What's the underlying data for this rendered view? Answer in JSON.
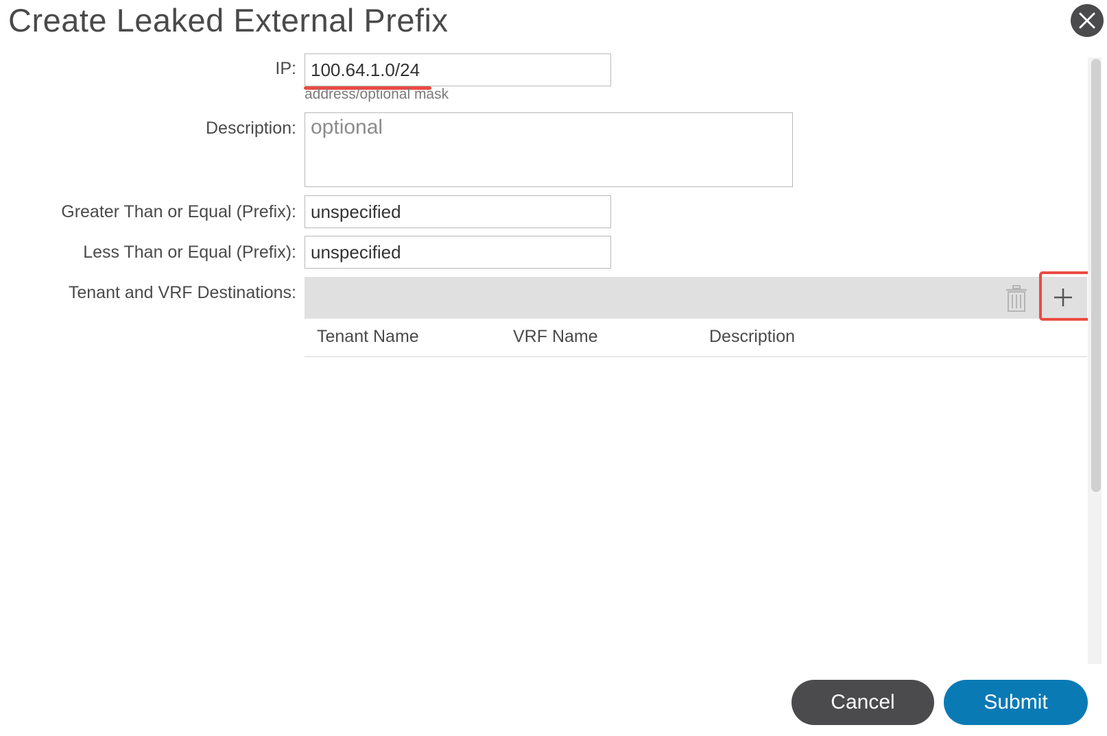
{
  "dialog": {
    "title": "Create Leaked External Prefix"
  },
  "form": {
    "ip": {
      "label": "IP:",
      "value": "100.64.1.0/24",
      "helper": "address/optional mask"
    },
    "description": {
      "label": "Description:",
      "placeholder": "optional"
    },
    "ge_prefix": {
      "label": "Greater Than or Equal (Prefix):",
      "value": "unspecified"
    },
    "le_prefix": {
      "label": "Less Than or Equal (Prefix):",
      "value": "unspecified"
    },
    "destinations": {
      "label": "Tenant and VRF Destinations:",
      "columns": [
        "Tenant Name",
        "VRF Name",
        "Description"
      ],
      "rows": []
    }
  },
  "footer": {
    "cancel_label": "Cancel",
    "submit_label": "Submit"
  },
  "icons": {
    "close": "close-icon",
    "trash": "trash-icon",
    "add": "plus-icon"
  },
  "colors": {
    "submit": "#0a7ab5",
    "cancel": "#4b4b4d",
    "highlight": "#ea4b43"
  }
}
